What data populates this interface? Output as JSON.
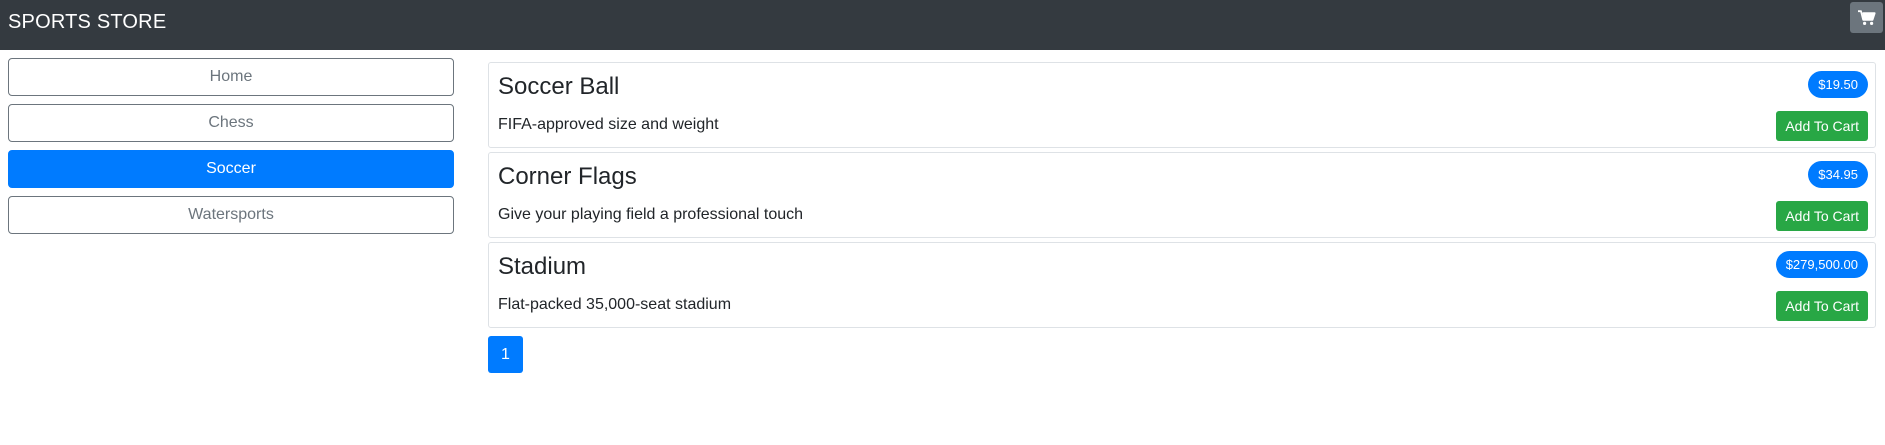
{
  "navbar": {
    "brand": "SPORTS STORE",
    "cart_icon": "shopping-cart-icon"
  },
  "categories": [
    {
      "label": "Home",
      "active": false
    },
    {
      "label": "Chess",
      "active": false
    },
    {
      "label": "Soccer",
      "active": true
    },
    {
      "label": "Watersports",
      "active": false
    }
  ],
  "products": [
    {
      "name": "Soccer Ball",
      "description": "FIFA-approved size and weight",
      "price": "$19.50",
      "button": "Add To Cart"
    },
    {
      "name": "Corner Flags",
      "description": "Give your playing field a professional touch",
      "price": "$34.95",
      "button": "Add To Cart"
    },
    {
      "name": "Stadium",
      "description": "Flat-packed 35,000-seat stadium",
      "price": "$279,500.00",
      "button": "Add To Cart"
    }
  ],
  "pagination": {
    "pages": [
      "1"
    ],
    "current": "1"
  },
  "colors": {
    "navbar": "#343a40",
    "primary": "#007bff",
    "success": "#28a745",
    "secondary": "#6c757d"
  }
}
